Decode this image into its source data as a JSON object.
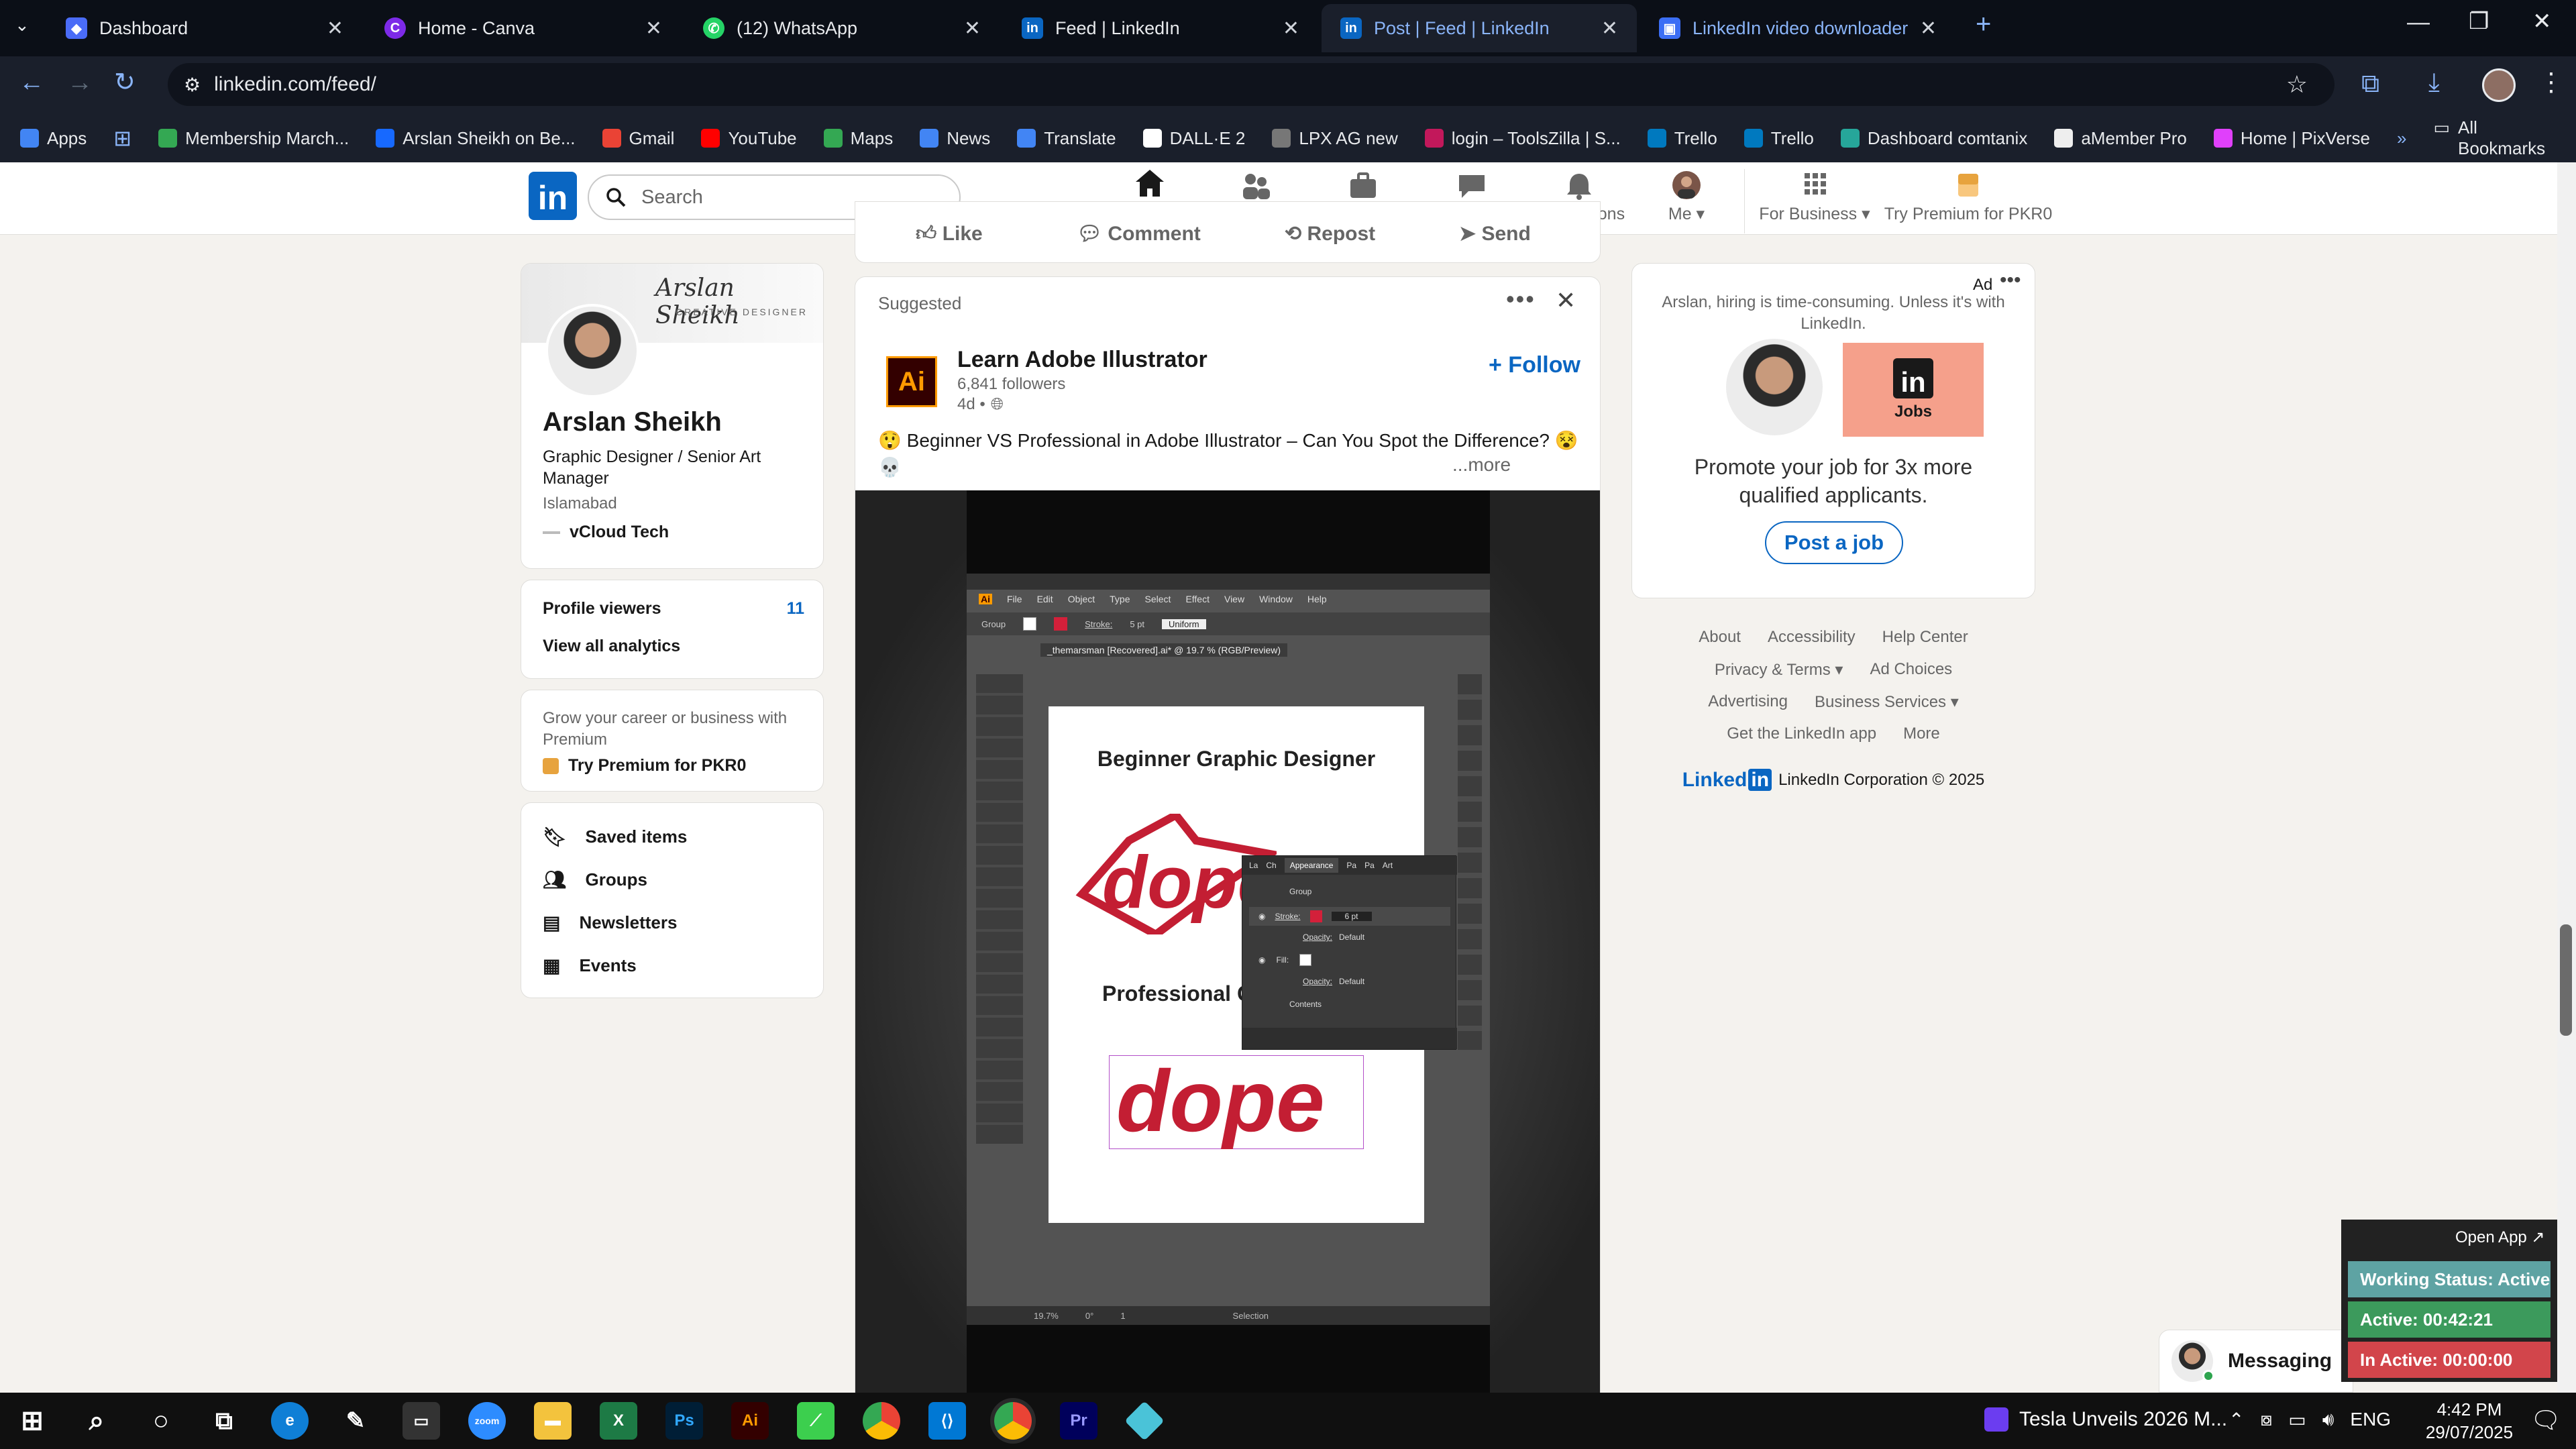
{
  "browser": {
    "tabs": [
      {
        "label": "Dashboard",
        "color": "#4a6cf7"
      },
      {
        "label": "Home - Canva",
        "color": "#7d2ae8"
      },
      {
        "label": "(12) WhatsApp",
        "color": "#25d366"
      },
      {
        "label": "Feed | LinkedIn",
        "color": "#0a66c2"
      },
      {
        "label": "Post | Feed | LinkedIn",
        "color": "#0a66c2"
      },
      {
        "label": "LinkedIn video downloader • G",
        "color": "#3b6ef5"
      }
    ],
    "url": "linkedin.com/feed/",
    "bookmarks": [
      {
        "label": "Apps",
        "color": "#4285f4"
      },
      {
        "label": "Membership March...",
        "color": "#34a853"
      },
      {
        "label": "Arslan Sheikh on Be...",
        "color": "#1769ff"
      },
      {
        "label": "Gmail",
        "color": "#ea4335"
      },
      {
        "label": "YouTube",
        "color": "#ff0000"
      },
      {
        "label": "Maps",
        "color": "#34a853"
      },
      {
        "label": "News",
        "color": "#4285f4"
      },
      {
        "label": "Translate",
        "color": "#4285f4"
      },
      {
        "label": "DALL·E 2",
        "color": "#ffffff"
      },
      {
        "label": "LPX AG new",
        "color": "#777777"
      },
      {
        "label": "login – ToolsZilla | S...",
        "color": "#c2185b"
      },
      {
        "label": "Trello",
        "color": "#0079bf"
      },
      {
        "label": "Trello",
        "color": "#0079bf"
      },
      {
        "label": "Dashboard comtanix",
        "color": "#26a69a"
      },
      {
        "label": "aMember Pro",
        "color": "#eeeeee"
      },
      {
        "label": "Home | PixVerse",
        "color": "#e040fb"
      }
    ],
    "all_bookmarks": "All Bookmarks"
  },
  "linkedin": {
    "search_placeholder": "Search",
    "nav": [
      {
        "label": "Home",
        "icon": "home-icon"
      },
      {
        "label": "My Network",
        "icon": "network-icon"
      },
      {
        "label": "Jobs",
        "icon": "jobs-icon"
      },
      {
        "label": "Messaging",
        "icon": "messaging-icon"
      },
      {
        "label": "Notifications",
        "icon": "bell-icon"
      },
      {
        "label": "Me",
        "icon": "avatar-icon"
      },
      {
        "label": "For Business",
        "icon": "grid-icon"
      },
      {
        "label": "Try Premium for PKR0",
        "icon": "premium-icon"
      }
    ],
    "profile": {
      "name": "Arslan Sheikh",
      "headline": "Graphic Designer / Senior Art Manager",
      "location": "Islamabad",
      "company": "vCloud Tech",
      "banner_title": "Arslan Sheikh",
      "banner_sub": "CREATIVE DESIGNER"
    },
    "analytics": {
      "viewers_label": "Profile viewers",
      "viewers_count": "11",
      "view_all": "View all analytics"
    },
    "premium_card": {
      "text": "Grow your career or business with Premium",
      "link": "Try Premium for PKR0"
    },
    "shortcuts": [
      "Saved items",
      "Groups",
      "Newsletters",
      "Events"
    ],
    "post_actions": [
      "Like",
      "Comment",
      "Repost",
      "Send"
    ],
    "post": {
      "suggested": "Suggested",
      "author": "Learn Adobe Illustrator",
      "followers": "6,841 followers",
      "time": "4d •",
      "follow": "+ Follow",
      "text": "Beginner VS Professional in Adobe Illustrator – Can You Spot the Difference?",
      "more": "...more"
    },
    "illustrator": {
      "menu": [
        "File",
        "Edit",
        "Object",
        "Type",
        "Select",
        "Effect",
        "View",
        "Window",
        "Help"
      ],
      "control": [
        "Group",
        "Stroke:",
        "5 pt",
        "Uniform"
      ],
      "doc_tab": "_themarsman [Recovered].ai* @ 19.7 % (RGB/Preview)",
      "artboard_title": "Beginner Graphic Designer",
      "artboard_title2": "Professional Gr",
      "logo_text": "dope",
      "appearance": {
        "tabs": [
          "La",
          "Ch",
          "Appearance",
          "Pa",
          "Pa",
          "Art"
        ],
        "group": "Group",
        "stroke": "Stroke:",
        "stroke_val": "6 pt",
        "opacity": "Opacity:",
        "opacity_val": "Default",
        "fill": "Fill:",
        "opacity2": "Opacity:",
        "opacity2_val": "Default",
        "contents": "Contents"
      },
      "status_zoom": "19.7%",
      "status_angle": "0°",
      "status_page": "1",
      "status_tool": "Selection"
    },
    "ad": {
      "label": "Ad",
      "text": "Arslan, hiring is time-consuming. Unless it's with LinkedIn.",
      "jobs": "Jobs",
      "promo": "Promote your job for 3x more qualified applicants.",
      "cta": "Post a job"
    },
    "footer": {
      "links_row1": [
        "About",
        "Accessibility",
        "Help Center"
      ],
      "links_row2": [
        "Privacy & Terms",
        "Ad Choices"
      ],
      "links_row3": [
        "Advertising",
        "Business Services"
      ],
      "links_row4": [
        "Get the LinkedIn app",
        "More"
      ],
      "brand": "Linked",
      "copyright": "LinkedIn Corporation © 2025"
    },
    "messaging": "Messaging"
  },
  "tracker": {
    "open_app": "Open App ↗",
    "working": "Working Status: Active",
    "active": "Active: 00:42:21",
    "inactive": "In Active: 00:00:00"
  },
  "taskbar": {
    "news": "Tesla Unveils 2026 M...",
    "lang": "ENG",
    "time": "4:42 PM",
    "date": "29/07/2025"
  }
}
